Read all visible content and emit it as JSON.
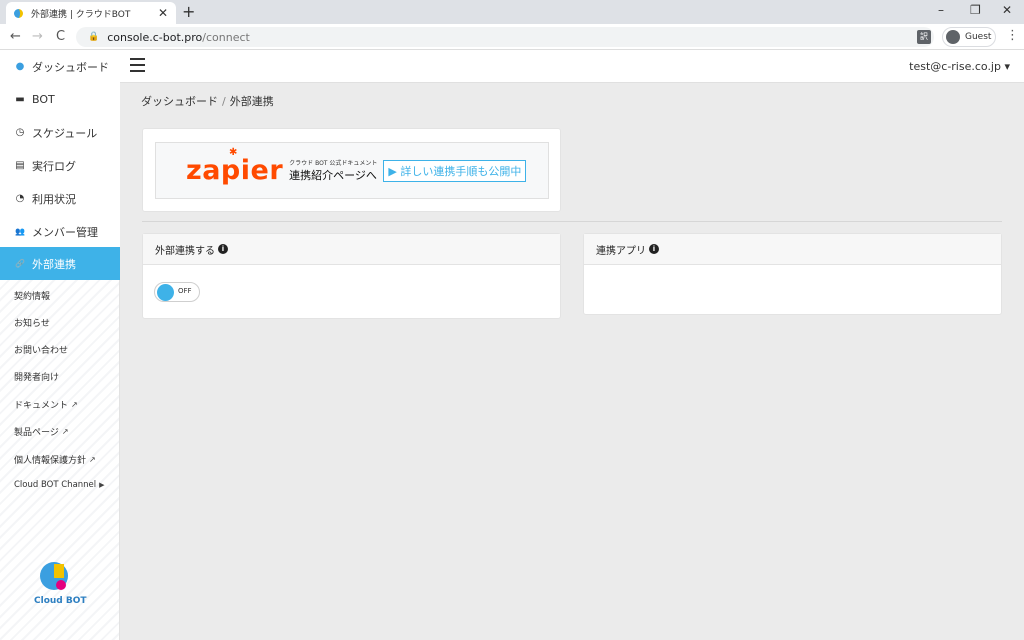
{
  "browser": {
    "tab_title": "外部連携 | クラウドBOT",
    "tab_close": "✕",
    "new_tab": "+",
    "minimize": "–",
    "restore": "❐",
    "close": "✕",
    "back": "←",
    "forward": "→",
    "reload": "C",
    "url_host": "console.c-bot.pro",
    "url_path": "/connect",
    "translate": "訳",
    "profile_name": "Guest",
    "menu": "⋮"
  },
  "sidebar": {
    "items": [
      {
        "label": "ダッシュボード",
        "icon": "●"
      },
      {
        "label": "BOT",
        "icon": "▬"
      },
      {
        "label": "スケジュール",
        "icon": "◷"
      },
      {
        "label": "実行ログ",
        "icon": "▤"
      },
      {
        "label": "利用状況",
        "icon": "◔"
      },
      {
        "label": "メンバー管理",
        "icon": "👥"
      },
      {
        "label": "外部連携",
        "icon": "🔗"
      }
    ],
    "links": [
      {
        "label": "契約情報",
        "ext": ""
      },
      {
        "label": "お知らせ",
        "ext": ""
      },
      {
        "label": "お問い合わせ",
        "ext": ""
      },
      {
        "label": "開発者向け",
        "ext": ""
      },
      {
        "label": "ドキュメント",
        "ext": "↗"
      },
      {
        "label": "製品ページ",
        "ext": "↗"
      },
      {
        "label": "個人情報保護方針",
        "ext": "↗"
      },
      {
        "label": "Cloud BOT Channel",
        "ext": "▶"
      }
    ],
    "logo_text": "Cloud BOT"
  },
  "topbar": {
    "user": "test@c-rise.co.jp ▾"
  },
  "breadcrumb": {
    "home": "ダッシュボード",
    "sep": "/",
    "current": "外部連携"
  },
  "banner": {
    "brand": "zapier",
    "star": "✱",
    "small": "クラウド BOT 公式ドキュメント",
    "big": "連携紹介ページへ",
    "cta": "▶ 詳しい連携手順も公開中"
  },
  "panels": {
    "integration_title": "外部連携する",
    "toggle_state": "OFF",
    "apps_title": "連携アプリ",
    "info": "i"
  },
  "colors": {
    "accent": "#3eb2e8",
    "zapier": "#ff4a00"
  }
}
